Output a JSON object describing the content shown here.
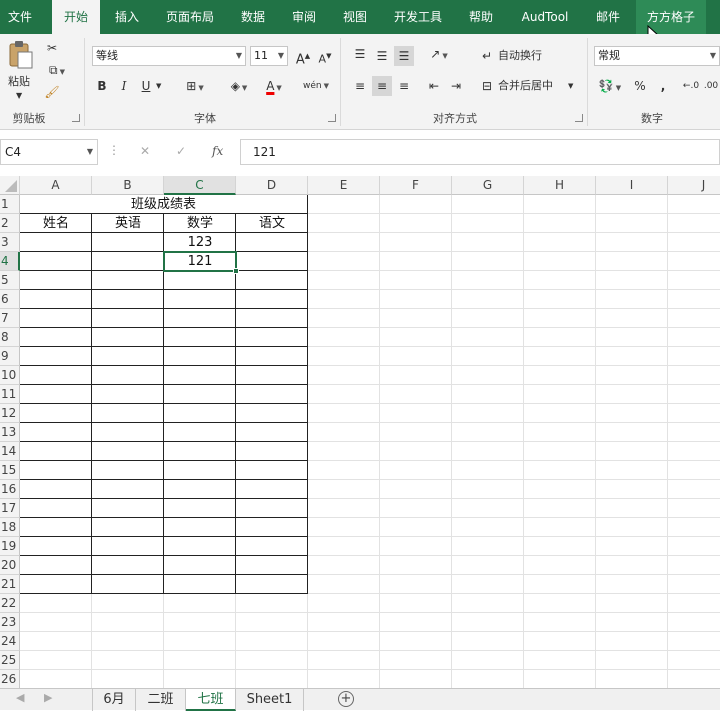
{
  "ribbon_tabs": [
    "文件",
    "开始",
    "插入",
    "页面布局",
    "数据",
    "审阅",
    "视图",
    "开发工具",
    "帮助",
    "AudTool",
    "邮件",
    "方方格子"
  ],
  "clipboard": {
    "paste_label": "粘贴",
    "group_label": "剪贴板"
  },
  "font": {
    "name": "等线",
    "size": "11",
    "bold": "B",
    "italic": "I",
    "underline": "U",
    "phonetic": "wén",
    "group_label": "字体"
  },
  "alignment": {
    "wrap_text": "自动换行",
    "merge_center": "合并后居中",
    "group_label": "对齐方式"
  },
  "number": {
    "format": "常规",
    "percent": "%",
    "comma": ",",
    "group_label": "数字"
  },
  "formula_bar": {
    "name_box": "C4",
    "cancel": "✕",
    "enter": "✓",
    "fx": "fx",
    "content": "121"
  },
  "columns": [
    "A",
    "B",
    "C",
    "D",
    "E",
    "F",
    "G",
    "H",
    "I",
    "J"
  ],
  "rows": [
    "1",
    "2",
    "3",
    "4",
    "5",
    "6",
    "7",
    "8",
    "9",
    "10",
    "11",
    "12",
    "13",
    "14",
    "15",
    "16",
    "17",
    "18",
    "19",
    "20",
    "21",
    "22",
    "23",
    "24",
    "25",
    "26"
  ],
  "cells": {
    "title": "班级成绩表",
    "header_name": "姓名",
    "header_english": "英语",
    "header_math": "数学",
    "header_chinese": "语文",
    "c3": "123",
    "c4": "121"
  },
  "sheet_tabs": [
    "6月",
    "二班",
    "七班",
    "Sheet1"
  ],
  "active_sheet": "七班",
  "colors": {
    "excel_green": "#217346",
    "selection_border": "#217346"
  }
}
